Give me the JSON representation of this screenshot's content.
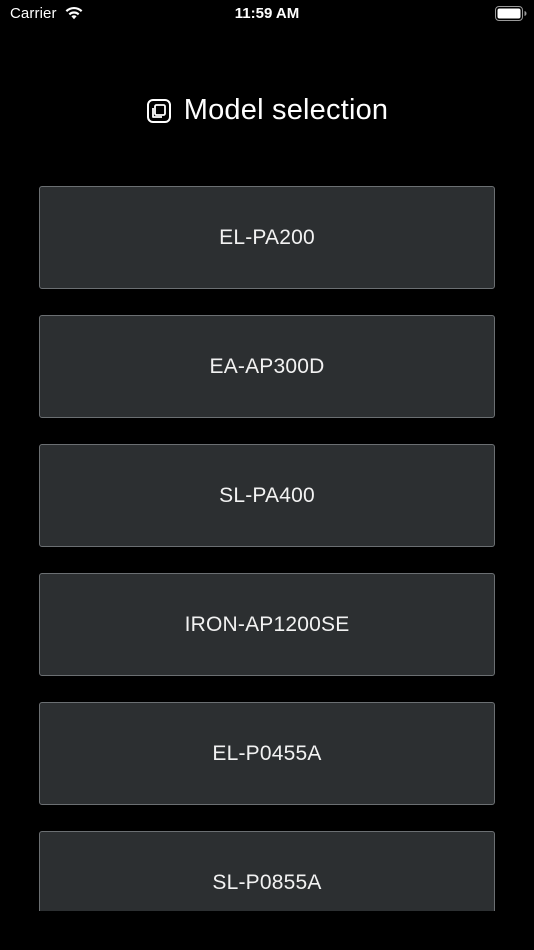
{
  "status_bar": {
    "carrier": "Carrier",
    "time": "11:59 AM",
    "wifi_icon": "wifi-icon",
    "battery_icon": "battery-icon"
  },
  "header": {
    "icon": "model-stack-icon",
    "title": "Model selection"
  },
  "models": [
    {
      "label": "EL-PA200"
    },
    {
      "label": "EA-AP300D"
    },
    {
      "label": "SL-PA400"
    },
    {
      "label": "IRON-AP1200SE"
    },
    {
      "label": "EL-P0455A"
    },
    {
      "label": "SL-P0855A"
    }
  ],
  "colors": {
    "background": "#000000",
    "button_fill": "#2c2f31",
    "button_border": "#6b6f72",
    "text": "#ffffff"
  }
}
